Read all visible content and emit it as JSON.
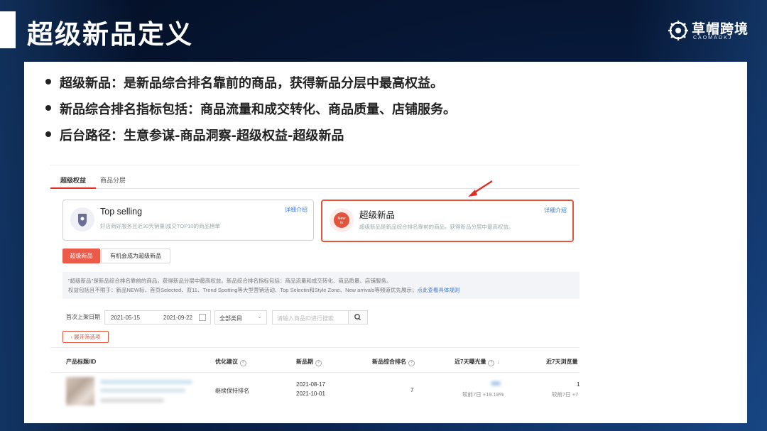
{
  "slide": {
    "title": "超级新品定义",
    "logo_text": "草帽跨境",
    "logo_sub": "CAOMAOKJ",
    "bullets": [
      "超级新品：是新品综合排名靠前的商品，获得新品分层中最高权益。",
      "新品综合排名指标包括：商品流量和成交转化、商品质量、店铺服务。",
      "后台路径：生意参谋-商品洞察-超级权益-超级新品"
    ]
  },
  "screenshot": {
    "tabs": [
      "超级权益",
      "商品分层"
    ],
    "cards": [
      {
        "title": "Top selling",
        "desc": "好店商好服务且近30天销量/成交TOP10的商品榜单",
        "link": "详细介绍",
        "badge": ""
      },
      {
        "title": "超级新品",
        "desc": "超级新品是新品综合排名靠前的商品，获得新品分层中最高权益。",
        "link": "详细介绍",
        "badge": "New in"
      }
    ],
    "buttons": {
      "primary": "超级新品",
      "secondary": "有机会成为超级新品"
    },
    "note": {
      "line1": "\"超级新品\"是新品综合排名靠前的商品，获得新品分层中最高权益。新品综合排名指标包括：商品流量和成交转化、商品质量、店铺服务。",
      "line2": "权益包括且不限于：新品NEW标、首页Selected、双11、Trend Spotting等大型营销活动、Top Selectin和Style Zone、New arrivals等频道优先展示；",
      "link": "点此查看具体规则"
    },
    "filter": {
      "label": "首次上架日期",
      "date_start": "2021-05-15",
      "date_end": "2021-09-22",
      "category": "全部类目",
      "search_placeholder": "请输入商品ID进行搜索",
      "expand_label": "展开筛选项"
    },
    "columns": [
      "产品标题/ID",
      "优化建议",
      "新品期",
      "新品综合排名",
      "近7天曝光量",
      "近7天浏览量"
    ],
    "row": {
      "suggestion": "继续保持排名",
      "period_start": "2021-08-17",
      "period_end": "2021-10-01",
      "rank": "7",
      "exposure_change": "较前7日 +19.18%",
      "views_value": "1",
      "views_change": "较前7日 +7"
    }
  },
  "colors": {
    "accent": "#e2553c",
    "link": "#3a7bd5",
    "background": "#061633"
  }
}
